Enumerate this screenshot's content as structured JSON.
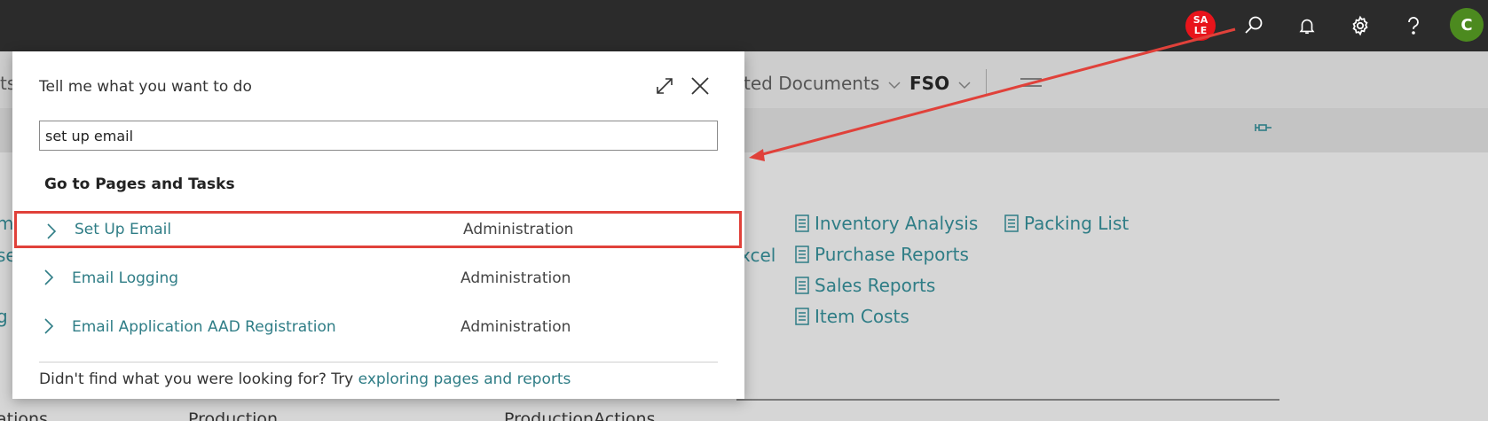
{
  "topbar": {
    "badge_text": "SA\nLE",
    "avatar_initial": "C",
    "icons": [
      "search-icon",
      "bell-icon",
      "gear-icon",
      "help-icon"
    ]
  },
  "background": {
    "nav": {
      "partial_left": "ts",
      "documents": "ted Documents",
      "fso": "FSO"
    },
    "left_edge": [
      "m",
      "se",
      "g"
    ],
    "excel_partial": "xcel",
    "links_col1": [
      "Inventory Analysis",
      "Purchase Reports",
      "Sales Reports",
      "Item Costs"
    ],
    "links_col2": [
      "Packing List"
    ],
    "bottom_labels": [
      "ations",
      "Production",
      "ProductionActions"
    ]
  },
  "dialog": {
    "title": "Tell me what you want to do",
    "search_value": "set up email",
    "section_title": "Go to Pages and Tasks",
    "results": [
      {
        "name": "Set Up Email",
        "category": "Administration",
        "selected": true
      },
      {
        "name": "Email Logging",
        "category": "Administration",
        "selected": false
      },
      {
        "name": "Email Application AAD Registration",
        "category": "Administration",
        "selected": false
      }
    ],
    "footer_text": "Didn't find what you were looking for? Try ",
    "footer_link": "exploring pages and reports"
  },
  "colors": {
    "topbar_bg": "#2b2b2b",
    "badge_red": "#e8141b",
    "avatar_green": "#4c8a1f",
    "link_teal": "#2f7d86",
    "highlight_red": "#e0413a"
  }
}
